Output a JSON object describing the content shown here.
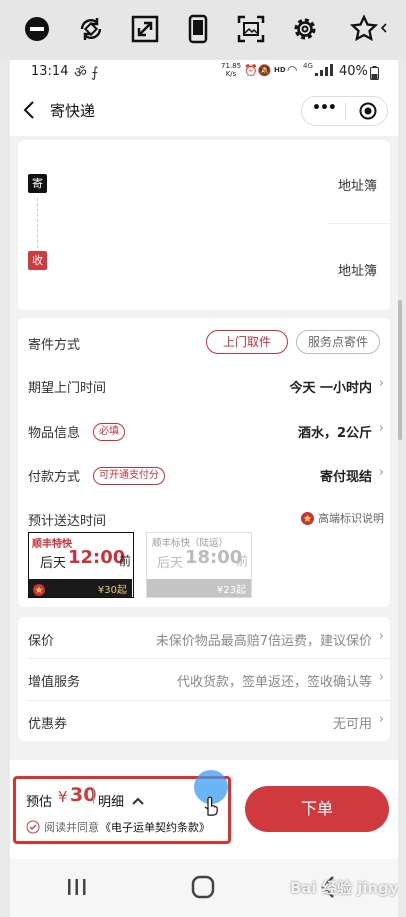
{
  "colors": {
    "accent": "#d03a3f",
    "dark": "#1a1a1a",
    "muted": "#888888"
  },
  "toolbar": {
    "icons": [
      "minus-circle-icon",
      "rotate-icon",
      "resize-icon",
      "phone-icon",
      "screenshot-icon",
      "gear-icon",
      "star-icon"
    ]
  },
  "status": {
    "time": "13:14",
    "net_speed_top": "71.85",
    "net_speed_bottom": "K/s",
    "network": "4G",
    "battery": "40%"
  },
  "nav": {
    "title": "寄快递",
    "more": "•••"
  },
  "address": {
    "send_tag": "寄",
    "recv_tag": "收",
    "send_book": "地址簿",
    "recv_book": "地址簿"
  },
  "service": {
    "method_label": "寄件方式",
    "method_primary": "上门取件",
    "method_secondary": "服务点寄件",
    "pickup_label": "期望上门时间",
    "pickup_value": "今天 一小时内",
    "item_label": "物品信息",
    "item_tag": "必填",
    "item_value": "酒水，2公斤",
    "pay_label": "付款方式",
    "pay_tag": "可开通支付分",
    "pay_value": "寄付现结",
    "eta_label": "预计送达时间",
    "eta_legend": "高端标识说明",
    "options": [
      {
        "name": "顺丰特快",
        "day": "后天",
        "time": "12:00",
        "suffix": "前",
        "price": "¥30起"
      },
      {
        "name": "顺丰标快（陆运）",
        "day": "后天",
        "time": "18:00",
        "suffix": "前",
        "price": "¥23起"
      }
    ]
  },
  "extras": {
    "insure_label": "保价",
    "insure_value": "未保价物品最高赔7倍运费，建议保价",
    "value_added_label": "增值服务",
    "value_added_value": "代收货款，签单返还，签收确认等",
    "coupon_label": "优惠券",
    "coupon_value": "无可用"
  },
  "footer": {
    "estimate_label": "预估",
    "currency": "¥",
    "amount": "30",
    "detail": "明细",
    "agree_prefix": "阅读并同意",
    "agree_link": "《电子运单契约条款》",
    "submit": "下单"
  },
  "watermark": "Bai 经验 jingyan.baidu.com"
}
